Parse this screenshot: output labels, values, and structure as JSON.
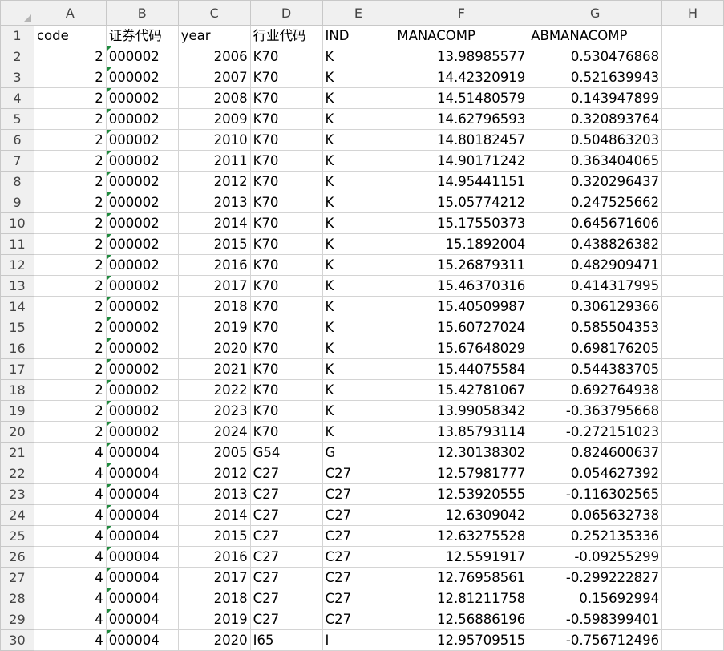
{
  "columns": [
    "A",
    "B",
    "C",
    "D",
    "E",
    "F",
    "G",
    "H"
  ],
  "header_row": {
    "number": "1",
    "cells": [
      "code",
      "证券代码",
      "year",
      "行业代码",
      "IND",
      "MANACOMP",
      "ABMANACOMP",
      ""
    ]
  },
  "rows": [
    {
      "n": "2",
      "code": "2",
      "sec": "000002",
      "year": "2006",
      "ind_code": "K70",
      "ind": "K",
      "manacomp": "13.98985577",
      "abmanacomp": "0.530476868"
    },
    {
      "n": "3",
      "code": "2",
      "sec": "000002",
      "year": "2007",
      "ind_code": "K70",
      "ind": "K",
      "manacomp": "14.42320919",
      "abmanacomp": "0.521639943"
    },
    {
      "n": "4",
      "code": "2",
      "sec": "000002",
      "year": "2008",
      "ind_code": "K70",
      "ind": "K",
      "manacomp": "14.51480579",
      "abmanacomp": "0.143947899"
    },
    {
      "n": "5",
      "code": "2",
      "sec": "000002",
      "year": "2009",
      "ind_code": "K70",
      "ind": "K",
      "manacomp": "14.62796593",
      "abmanacomp": "0.320893764"
    },
    {
      "n": "6",
      "code": "2",
      "sec": "000002",
      "year": "2010",
      "ind_code": "K70",
      "ind": "K",
      "manacomp": "14.80182457",
      "abmanacomp": "0.504863203"
    },
    {
      "n": "7",
      "code": "2",
      "sec": "000002",
      "year": "2011",
      "ind_code": "K70",
      "ind": "K",
      "manacomp": "14.90171242",
      "abmanacomp": "0.363404065"
    },
    {
      "n": "8",
      "code": "2",
      "sec": "000002",
      "year": "2012",
      "ind_code": "K70",
      "ind": "K",
      "manacomp": "14.95441151",
      "abmanacomp": "0.320296437"
    },
    {
      "n": "9",
      "code": "2",
      "sec": "000002",
      "year": "2013",
      "ind_code": "K70",
      "ind": "K",
      "manacomp": "15.05774212",
      "abmanacomp": "0.247525662"
    },
    {
      "n": "10",
      "code": "2",
      "sec": "000002",
      "year": "2014",
      "ind_code": "K70",
      "ind": "K",
      "manacomp": "15.17550373",
      "abmanacomp": "0.645671606"
    },
    {
      "n": "11",
      "code": "2",
      "sec": "000002",
      "year": "2015",
      "ind_code": "K70",
      "ind": "K",
      "manacomp": "15.1892004",
      "abmanacomp": "0.438826382"
    },
    {
      "n": "12",
      "code": "2",
      "sec": "000002",
      "year": "2016",
      "ind_code": "K70",
      "ind": "K",
      "manacomp": "15.26879311",
      "abmanacomp": "0.482909471"
    },
    {
      "n": "13",
      "code": "2",
      "sec": "000002",
      "year": "2017",
      "ind_code": "K70",
      "ind": "K",
      "manacomp": "15.46370316",
      "abmanacomp": "0.414317995"
    },
    {
      "n": "14",
      "code": "2",
      "sec": "000002",
      "year": "2018",
      "ind_code": "K70",
      "ind": "K",
      "manacomp": "15.40509987",
      "abmanacomp": "0.306129366"
    },
    {
      "n": "15",
      "code": "2",
      "sec": "000002",
      "year": "2019",
      "ind_code": "K70",
      "ind": "K",
      "manacomp": "15.60727024",
      "abmanacomp": "0.585504353"
    },
    {
      "n": "16",
      "code": "2",
      "sec": "000002",
      "year": "2020",
      "ind_code": "K70",
      "ind": "K",
      "manacomp": "15.67648029",
      "abmanacomp": "0.698176205"
    },
    {
      "n": "17",
      "code": "2",
      "sec": "000002",
      "year": "2021",
      "ind_code": "K70",
      "ind": "K",
      "manacomp": "15.44075584",
      "abmanacomp": "0.544383705"
    },
    {
      "n": "18",
      "code": "2",
      "sec": "000002",
      "year": "2022",
      "ind_code": "K70",
      "ind": "K",
      "manacomp": "15.42781067",
      "abmanacomp": "0.692764938"
    },
    {
      "n": "19",
      "code": "2",
      "sec": "000002",
      "year": "2023",
      "ind_code": "K70",
      "ind": "K",
      "manacomp": "13.99058342",
      "abmanacomp": "-0.363795668"
    },
    {
      "n": "20",
      "code": "2",
      "sec": "000002",
      "year": "2024",
      "ind_code": "K70",
      "ind": "K",
      "manacomp": "13.85793114",
      "abmanacomp": "-0.272151023"
    },
    {
      "n": "21",
      "code": "4",
      "sec": "000004",
      "year": "2005",
      "ind_code": "G54",
      "ind": "G",
      "manacomp": "12.30138302",
      "abmanacomp": "0.824600637"
    },
    {
      "n": "22",
      "code": "4",
      "sec": "000004",
      "year": "2012",
      "ind_code": "C27",
      "ind": "C27",
      "manacomp": "12.57981777",
      "abmanacomp": "0.054627392"
    },
    {
      "n": "23",
      "code": "4",
      "sec": "000004",
      "year": "2013",
      "ind_code": "C27",
      "ind": "C27",
      "manacomp": "12.53920555",
      "abmanacomp": "-0.116302565"
    },
    {
      "n": "24",
      "code": "4",
      "sec": "000004",
      "year": "2014",
      "ind_code": "C27",
      "ind": "C27",
      "manacomp": "12.6309042",
      "abmanacomp": "0.065632738"
    },
    {
      "n": "25",
      "code": "4",
      "sec": "000004",
      "year": "2015",
      "ind_code": "C27",
      "ind": "C27",
      "manacomp": "12.63275528",
      "abmanacomp": "0.252135336"
    },
    {
      "n": "26",
      "code": "4",
      "sec": "000004",
      "year": "2016",
      "ind_code": "C27",
      "ind": "C27",
      "manacomp": "12.5591917",
      "abmanacomp": "-0.09255299"
    },
    {
      "n": "27",
      "code": "4",
      "sec": "000004",
      "year": "2017",
      "ind_code": "C27",
      "ind": "C27",
      "manacomp": "12.76958561",
      "abmanacomp": "-0.299222827"
    },
    {
      "n": "28",
      "code": "4",
      "sec": "000004",
      "year": "2018",
      "ind_code": "C27",
      "ind": "C27",
      "manacomp": "12.81211758",
      "abmanacomp": "0.15692994"
    },
    {
      "n": "29",
      "code": "4",
      "sec": "000004",
      "year": "2019",
      "ind_code": "C27",
      "ind": "C27",
      "manacomp": "12.56886196",
      "abmanacomp": "-0.598399401"
    },
    {
      "n": "30",
      "code": "4",
      "sec": "000004",
      "year": "2020",
      "ind_code": "I65",
      "ind": "I",
      "manacomp": "12.95709515",
      "abmanacomp": "-0.756712496"
    }
  ],
  "colors": {
    "grid": "#d4d4d4",
    "header_bg": "#f0f0f0",
    "text_flag": "#1e8a3c"
  }
}
